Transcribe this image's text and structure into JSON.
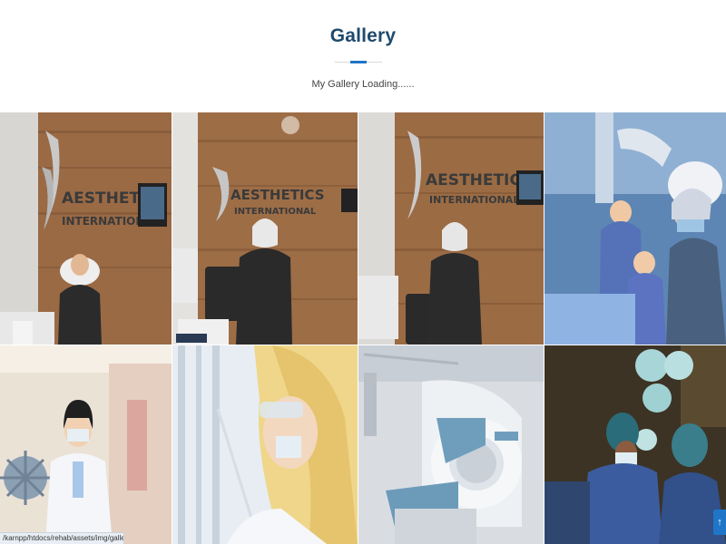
{
  "section": {
    "title": "Gallery",
    "subtitle": "My Gallery Loading......"
  },
  "gallery": {
    "images": [
      {
        "name": "aesthetics-reception-photo",
        "sign_text": "AESTHETICS INTERNATIONAL"
      },
      {
        "name": "aesthetics-staff-standing-photo",
        "sign_text": "AESTHETICS INTERNATIONAL"
      },
      {
        "name": "aesthetics-staff-arms-crossed-photo",
        "sign_text": "AESTHETICS INTERNATIONAL"
      },
      {
        "name": "surgery-team-photo"
      },
      {
        "name": "doctor-virus-photo"
      },
      {
        "name": "lab-scientist-photo"
      },
      {
        "name": "mri-scanner-photo"
      },
      {
        "name": "operating-room-photo"
      }
    ]
  },
  "status_bar": {
    "url": "/karnpp/htdocs/rehab/assets/img/gallery/gallery-3.jpg"
  },
  "back_to_top": {
    "icon": "arrow-up-icon",
    "glyph": "↑"
  }
}
